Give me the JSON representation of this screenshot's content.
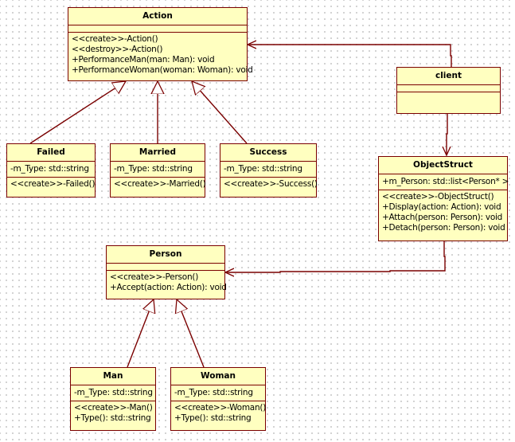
{
  "diagram": {
    "type": "UML class diagram",
    "colors": {
      "fill": "#ffffc0",
      "stroke": "#7a0000",
      "grid": "#c4c4c4"
    },
    "classes": {
      "action": {
        "name": "Action",
        "attributes": [],
        "operations": [
          "<<create>>-Action()",
          "<<destroy>>-Action()",
          "+PerformanceMan(man: Man): void",
          "+PerformanceWoman(woman: Woman): void"
        ]
      },
      "failed": {
        "name": "Failed",
        "attributes": [
          "-m_Type: std::string"
        ],
        "operations": [
          "<<create>>-Failed()"
        ]
      },
      "married": {
        "name": "Married",
        "attributes": [
          "-m_Type: std::string"
        ],
        "operations": [
          "<<create>>-Married()"
        ]
      },
      "success": {
        "name": "Success",
        "attributes": [
          "-m_Type: std::string"
        ],
        "operations": [
          "<<create>>-Success()"
        ]
      },
      "client": {
        "name": "client",
        "attributes": [],
        "operations": []
      },
      "objectstruct": {
        "name": "ObjectStruct",
        "attributes": [
          "+m_Person: std::list<Person* >"
        ],
        "operations": [
          "<<create>>-ObjectStruct()",
          "+Display(action: Action): void",
          "+Attach(person: Person): void",
          "+Detach(person: Person): void"
        ]
      },
      "person": {
        "name": "Person",
        "attributes": [],
        "operations": [
          "<<create>>-Person()",
          "+Accept(action: Action): void"
        ]
      },
      "man": {
        "name": "Man",
        "attributes": [
          "-m_Type: std::string"
        ],
        "operations": [
          "<<create>>-Man()",
          "+Type(): std::string"
        ]
      },
      "woman": {
        "name": "Woman",
        "attributes": [
          "-m_Type: std::string"
        ],
        "operations": [
          "<<create>>-Woman()",
          "+Type(): std::string"
        ]
      }
    },
    "relations": [
      {
        "kind": "generalization",
        "from": "Failed",
        "to": "Action"
      },
      {
        "kind": "generalization",
        "from": "Married",
        "to": "Action"
      },
      {
        "kind": "generalization",
        "from": "Success",
        "to": "Action"
      },
      {
        "kind": "association",
        "from": "client",
        "to": "Action"
      },
      {
        "kind": "association",
        "from": "client",
        "to": "ObjectStruct"
      },
      {
        "kind": "association",
        "from": "ObjectStruct",
        "to": "Person"
      },
      {
        "kind": "generalization",
        "from": "Man",
        "to": "Person"
      },
      {
        "kind": "generalization",
        "from": "Woman",
        "to": "Person"
      }
    ]
  }
}
